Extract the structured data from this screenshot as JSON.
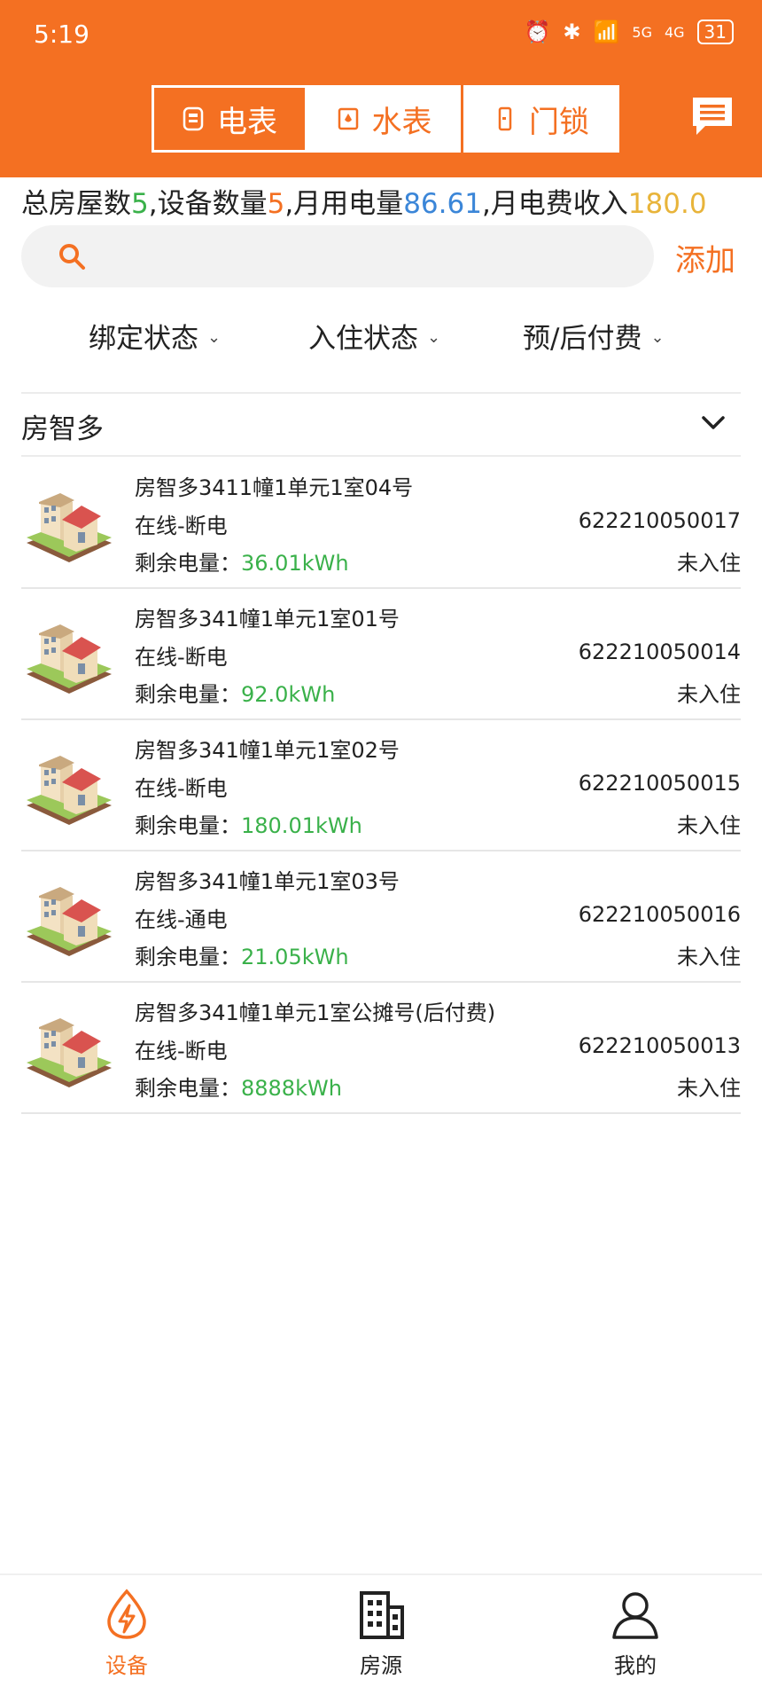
{
  "status_bar": {
    "time": "5:19",
    "network": "4G",
    "network2": "5G",
    "battery": "31"
  },
  "tabs": [
    {
      "label": "电表",
      "icon": "meter-icon",
      "active": true
    },
    {
      "label": "水表",
      "icon": "water-meter-icon",
      "active": false
    },
    {
      "label": "门锁",
      "icon": "door-lock-icon",
      "active": false
    }
  ],
  "summary": {
    "houses_label": "总房屋数",
    "houses_value": "5",
    "devices_label": ",设备数量",
    "devices_value": "5",
    "power_label": ",月用电量",
    "power_value": "86.61",
    "income_label": ",月电费收入",
    "income_value": "180.0"
  },
  "search": {
    "placeholder": "",
    "value": ""
  },
  "add_label": "添加",
  "filters": [
    {
      "label": "绑定状态"
    },
    {
      "label": "入住状态"
    },
    {
      "label": "预/后付费"
    }
  ],
  "group": {
    "title": "房智多"
  },
  "devices": [
    {
      "name": "房智多3411幢1单元1室04号",
      "status": "在线-断电",
      "remain_label": "剩余电量：",
      "remain_value": "36.01kWh",
      "device_id": "622210050017",
      "occupancy": "未入住"
    },
    {
      "name": "房智多341幢1单元1室01号",
      "status": "在线-断电",
      "remain_label": "剩余电量：",
      "remain_value": "92.0kWh",
      "device_id": "622210050014",
      "occupancy": "未入住"
    },
    {
      "name": "房智多341幢1单元1室02号",
      "status": "在线-断电",
      "remain_label": "剩余电量：",
      "remain_value": "180.01kWh",
      "device_id": "622210050015",
      "occupancy": "未入住"
    },
    {
      "name": "房智多341幢1单元1室03号",
      "status": "在线-通电",
      "remain_label": "剩余电量：",
      "remain_value": "21.05kWh",
      "device_id": "622210050016",
      "occupancy": "未入住"
    },
    {
      "name": "房智多341幢1单元1室公摊号(后付费)",
      "status": "在线-断电",
      "remain_label": "剩余电量：",
      "remain_value": "8888kWh",
      "device_id": "622210050013",
      "occupancy": "未入住"
    }
  ],
  "bottom_nav": [
    {
      "label": "设备",
      "icon": "device-lightning-icon",
      "active": true
    },
    {
      "label": "房源",
      "icon": "building-icon",
      "active": false
    },
    {
      "label": "我的",
      "icon": "profile-icon",
      "active": false
    }
  ],
  "colors": {
    "brand": "#f47022",
    "green": "#3ab14a",
    "blue": "#3b86d8",
    "gold": "#e8b43a"
  }
}
